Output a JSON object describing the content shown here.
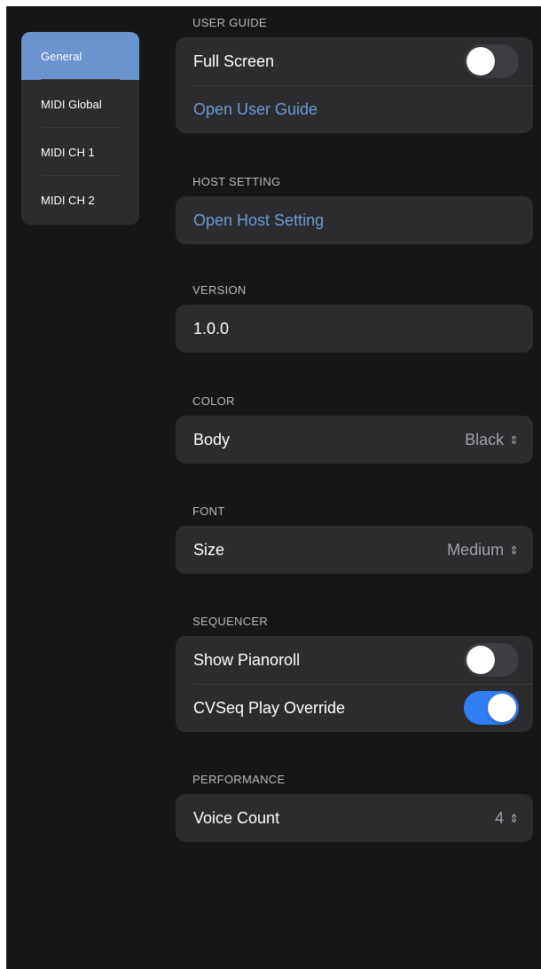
{
  "sidebar": {
    "items": [
      {
        "label": "General",
        "selected": true
      },
      {
        "label": "MIDI Global",
        "selected": false
      },
      {
        "label": "MIDI CH 1",
        "selected": false
      },
      {
        "label": "MIDI CH 2",
        "selected": false
      }
    ]
  },
  "user_guide": {
    "header": "USER GUIDE",
    "full_screen_label": "Full Screen",
    "full_screen_on": false,
    "open_label": "Open User Guide"
  },
  "host_setting": {
    "header": "HOST SETTING",
    "open_label": "Open Host Setting"
  },
  "version": {
    "header": "VERSION",
    "value": "1.0.0"
  },
  "color": {
    "header": "COLOR",
    "body_label": "Body",
    "body_value": "Black"
  },
  "font": {
    "header": "FONT",
    "size_label": "Size",
    "size_value": "Medium"
  },
  "sequencer": {
    "header": "SEQUENCER",
    "pianoroll_label": "Show Pianoroll",
    "pianoroll_on": false,
    "cvseq_label": "CVSeq Play Override",
    "cvseq_on": true
  },
  "performance": {
    "header": "PERFORMANCE",
    "voice_label": "Voice Count",
    "voice_value": "4"
  },
  "icons": {
    "chevron": "chevron-up-down-icon"
  },
  "colors": {
    "background": "#161617",
    "group": "#2c2c2e",
    "accent_link": "#6e9ad9",
    "sidebar_selected": "#6b93cf",
    "toggle_on": "#2f7ef6",
    "toggle_off": "#3e3e42"
  }
}
